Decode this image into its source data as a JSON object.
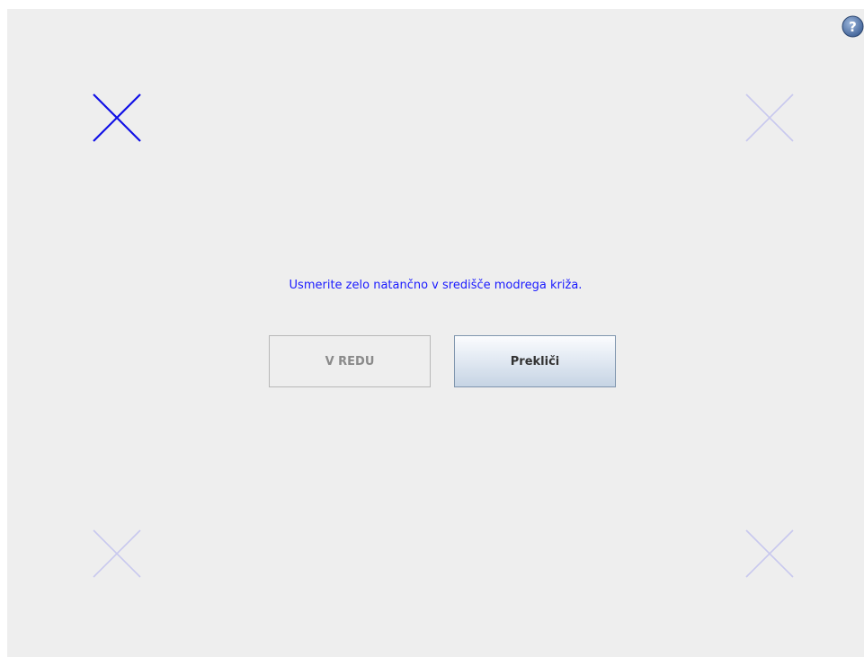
{
  "instruction": "Usmerite zelo natančno v središče modrega križa.",
  "buttons": {
    "ok_label": "V REDU",
    "cancel_label": "Prekliči"
  },
  "help": {
    "icon": "help-icon",
    "glyph": "?"
  },
  "targets": {
    "active": "top-left",
    "colors": {
      "active": "#1010e6",
      "inactive": "#c8c8ee",
      "background": "#eeeeee"
    }
  }
}
